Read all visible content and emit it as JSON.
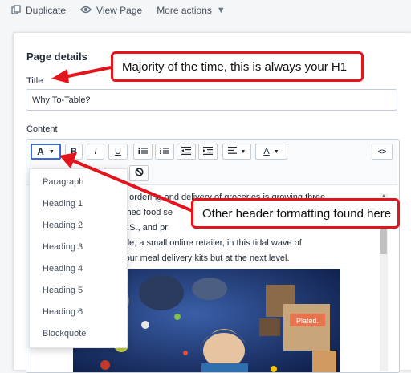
{
  "top_actions": {
    "duplicate": "Duplicate",
    "view_page": "View Page",
    "more_actions": "More actions"
  },
  "page_details": {
    "section_title": "Page details",
    "title_label": "Title",
    "title_value": "Why To-Table?",
    "content_label": "Content"
  },
  "toolbar": {
    "heading_button": "A",
    "bold": "B",
    "italic": "I",
    "underline": "U",
    "code": "<>"
  },
  "editor_text": [
    "line ordering and delivery of groceries is growing three",
    "blished food se",
    "e U.S., and pr",
    "Table, a small online retailer, in this tidal wave of",
    "e your meal delivery kits but at the next level."
  ],
  "photo": {
    "box_label": "Plated."
  },
  "heading_menu": [
    "Paragraph",
    "Heading 1",
    "Heading 2",
    "Heading 3",
    "Heading 4",
    "Heading 5",
    "Heading 6",
    "Blockquote"
  ],
  "annotations": {
    "title_callout": "Majority of the time, this is always your H1",
    "menu_callout": "Other header formatting found here"
  },
  "colors": {
    "annotation_red": "#e3141c",
    "selected_outline": "#3a6bd4"
  }
}
